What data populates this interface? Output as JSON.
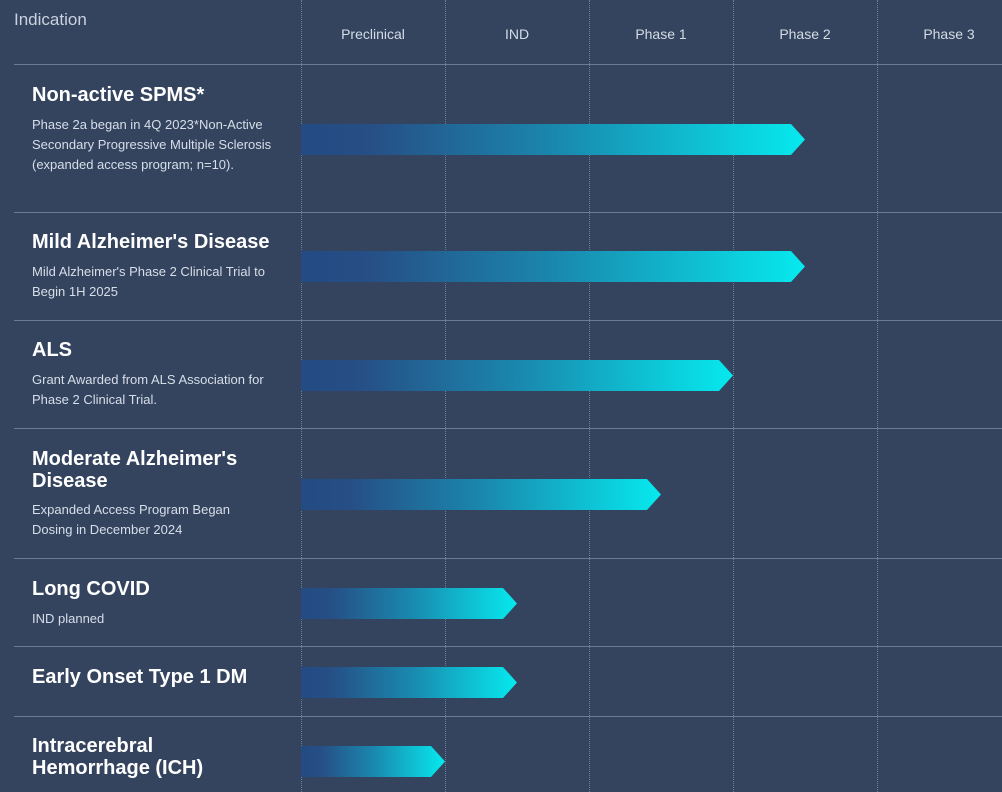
{
  "header": {
    "indication_label": "Indication",
    "phases": [
      "Preclinical",
      "IND",
      "Phase 1",
      "Phase 2",
      "Phase 3"
    ]
  },
  "colors": {
    "background": "#34445f",
    "bar_start": "#244b83",
    "bar_end": "#06e9ee"
  },
  "programs": [
    {
      "title": "Non-active SPMS*",
      "description": "Phase 2a began in 4Q 2023*Non-Active Secondary Progressive Multiple Sclerosis (expanded access program; n=10).",
      "progress_phases": 3.5
    },
    {
      "title": "Mild Alzheimer's Disease",
      "description": "Mild Alzheimer's Phase 2 Clinical Trial to Begin 1H 2025",
      "progress_phases": 3.5
    },
    {
      "title": "ALS",
      "description": "Grant Awarded from ALS Association for Phase 2 Clinical Trial.",
      "progress_phases": 3.0
    },
    {
      "title": "Moderate Alzheimer's Disease",
      "description": "Expanded Access Program Began Dosing in December 2024",
      "progress_phases": 2.5
    },
    {
      "title": "Long COVID",
      "description": "IND planned",
      "progress_phases": 1.5
    },
    {
      "title": "Early Onset Type 1 DM",
      "description": "",
      "progress_phases": 1.5
    },
    {
      "title": "Intracerebral Hemorrhage (ICH)",
      "description": "",
      "progress_phases": 1.0
    }
  ]
}
